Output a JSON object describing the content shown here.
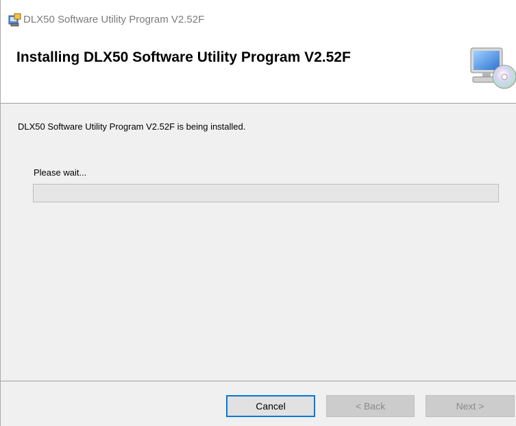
{
  "window": {
    "title": "DLX50 Software Utility Program V2.52F"
  },
  "banner": {
    "heading": "Installing DLX50 Software Utility Program V2.52F",
    "icon": "computer-cd-icon"
  },
  "content": {
    "status_text": "DLX50 Software Utility Program V2.52F is being installed.",
    "wait_label": "Please wait...",
    "progress_value": 0
  },
  "buttons": {
    "cancel_label": "Cancel",
    "back_label": "< Back",
    "next_label": "Next >"
  },
  "colors": {
    "accent": "#0078d7",
    "progress_fill": "#06b025"
  }
}
